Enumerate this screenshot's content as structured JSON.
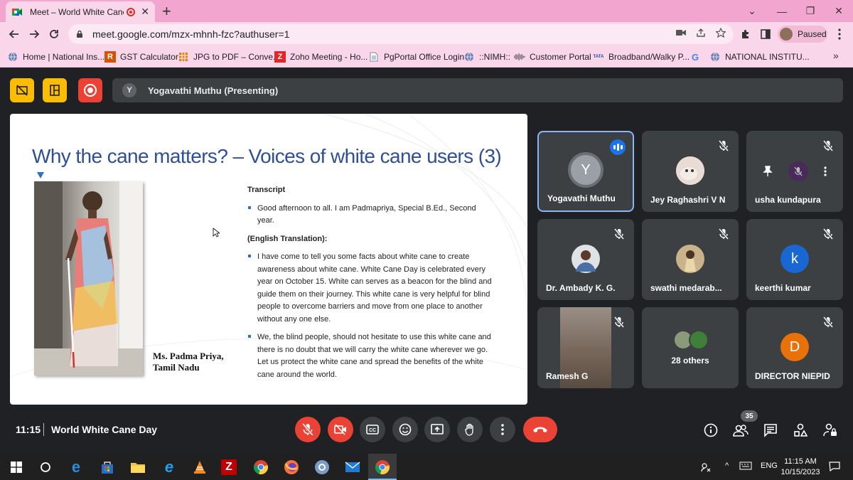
{
  "browser": {
    "tab_title": "Meet – World White Cane D",
    "url": "meet.google.com/mzx-mhnh-fzc?authuser=1",
    "profile_label": "Paused",
    "bookmarks": [
      {
        "label": "Home | National Ins...",
        "icon": "globe-icon"
      },
      {
        "label": "GST Calculator",
        "icon": "r-logo-icon"
      },
      {
        "label": "JPG to PDF – Conve...",
        "icon": "grid-icon"
      },
      {
        "label": "Zoho Meeting - Ho...",
        "icon": "z-logo-icon"
      },
      {
        "label": "PgPortal Office Login",
        "icon": "doc-icon"
      },
      {
        "label": "::NIMH::",
        "icon": "globe-icon"
      },
      {
        "label": "Customer Portal",
        "icon": "bars-icon"
      },
      {
        "label": "Broadband/Walky P...",
        "icon": "tata-icon"
      },
      {
        "label": "",
        "icon": "google-icon"
      },
      {
        "label": "NATIONAL INSTITU...",
        "icon": "globe-icon"
      }
    ]
  },
  "meet": {
    "presenter_initial": "Y",
    "presenter_label": "Yogavathi Muthu (Presenting)",
    "clock": "11:15",
    "meeting_title": "World White Cane Day",
    "participant_count": "35",
    "colors": {
      "accent": "#8ab4f8",
      "danger": "#ea4335",
      "background": "#202124",
      "tile": "#3c4043"
    }
  },
  "slide": {
    "title": "Why the cane matters? – Voices of white cane users (3)",
    "caption_line1": "Ms. Padma Priya,",
    "caption_line2": "Tamil Nadu",
    "transcript_heading": "Transcript",
    "transcript_item": "Good afternoon to all. I am Padmapriya, Special B.Ed., Second year.",
    "translation_heading": "(English Translation):",
    "translation_item1": "I have come to tell you some facts about white cane to create awareness about white cane. White Cane Day is celebrated every year on October 15. White can serves as a beacon for the blind and guide them on their journey. This white cane is very helpful for blind people to overcome barriers and move from one place to another without any one else.",
    "translation_item2": "We, the blind people, should not hesitate to use this white cane and there is no doubt that we will carry the white cane wherever we go. Let us protect the white cane and spread the benefits of the white cane around the world."
  },
  "participants": [
    {
      "name": "Yogavathi Muthu",
      "initial": "Y",
      "avatar_color": "#9aa0a6",
      "state": "speaking"
    },
    {
      "name": "Jey Raghashri V N",
      "avatar_color": "#d9c2b8",
      "state": "muted"
    },
    {
      "name": "usha kundapura",
      "state": "hover-controls"
    },
    {
      "name": "Dr. Ambady K. G.",
      "avatar_color": "#5d6b7a",
      "state": "muted"
    },
    {
      "name": "swathi medarab...",
      "avatar_color": "#b7a06a",
      "state": "muted"
    },
    {
      "name": "keerthi kumar",
      "initial": "k",
      "avatar_color": "#1967d2",
      "state": "muted"
    },
    {
      "name": "Ramesh G",
      "state": "video-muted"
    },
    {
      "name": "28 others",
      "state": "group"
    },
    {
      "name": "DIRECTOR NIEPID",
      "initial": "D",
      "avatar_color": "#e8710a",
      "state": "muted"
    }
  ],
  "taskbar": {
    "language": "ENG",
    "time": "11:15 AM",
    "date": "10/15/2023"
  }
}
